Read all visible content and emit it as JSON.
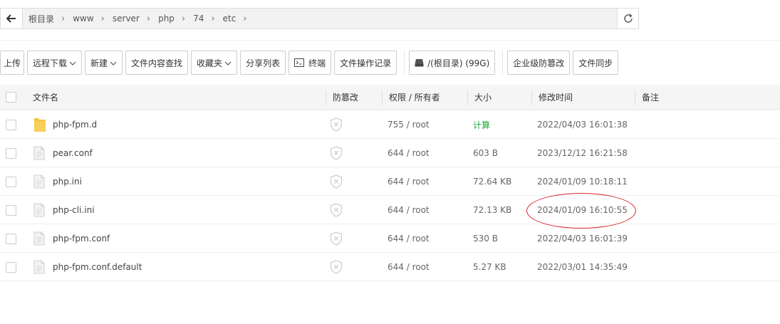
{
  "path": {
    "crumbs": [
      "根目录",
      "www",
      "server",
      "php",
      "74",
      "etc"
    ]
  },
  "toolbar": {
    "upload": "上传",
    "remote_download": "远程下载",
    "new": "新建",
    "content_search": "文件内容查找",
    "favorites": "收藏夹",
    "share_list": "分享列表",
    "terminal": "终端",
    "operation_log": "文件操作记录",
    "disk": "/(根目录) (99G)",
    "enterprise_tamper": "企业级防篡改",
    "sync": "文件同步"
  },
  "table": {
    "headers": {
      "name": "文件名",
      "tamper": "防篡改",
      "perm": "权限 / 所有者",
      "size": "大小",
      "mtime": "修改时间",
      "note": "备注"
    },
    "rows": [
      {
        "name": "php-fpm.d",
        "type": "folder",
        "perm": "755 / root",
        "size": "计算",
        "mtime": "2022/04/03 16:01:38"
      },
      {
        "name": "pear.conf",
        "type": "file",
        "perm": "644 / root",
        "size": "603 B",
        "mtime": "2023/12/12 16:21:58"
      },
      {
        "name": "php.ini",
        "type": "file",
        "perm": "644 / root",
        "size": "72.64 KB",
        "mtime": "2024/01/09 10:18:11"
      },
      {
        "name": "php-cli.ini",
        "type": "file",
        "perm": "644 / root",
        "size": "72.13 KB",
        "mtime": "2024/01/09 16:10:55"
      },
      {
        "name": "php-fpm.conf",
        "type": "file",
        "perm": "644 / root",
        "size": "530 B",
        "mtime": "2022/04/03 16:01:39"
      },
      {
        "name": "php-fpm.conf.default",
        "type": "file",
        "perm": "644 / root",
        "size": "5.27 KB",
        "mtime": "2022/03/01 14:35:49"
      }
    ]
  },
  "colors": {
    "calc_green": "#20a53a",
    "highlight_red": "#d8262b",
    "folder_yellow": "#f6c343"
  }
}
